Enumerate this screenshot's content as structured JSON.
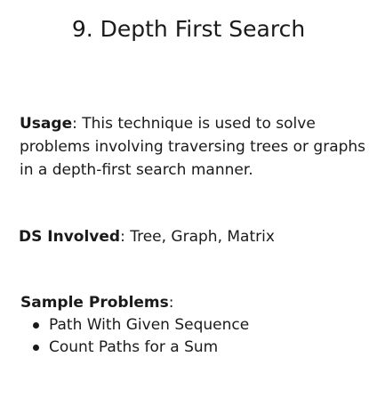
{
  "title": "9. Depth First Search",
  "usage": {
    "label": "Usage",
    "text": ": This technique is used to solve problems involving traversing trees or graphs in a depth-first search manner."
  },
  "ds_involved": {
    "label": "DS Involved",
    "text": ": Tree, Graph, Matrix"
  },
  "sample_problems": {
    "label": "Sample Problems",
    "suffix": ":",
    "items": [
      "Path With Given Sequence",
      "Count Paths for a Sum"
    ]
  }
}
